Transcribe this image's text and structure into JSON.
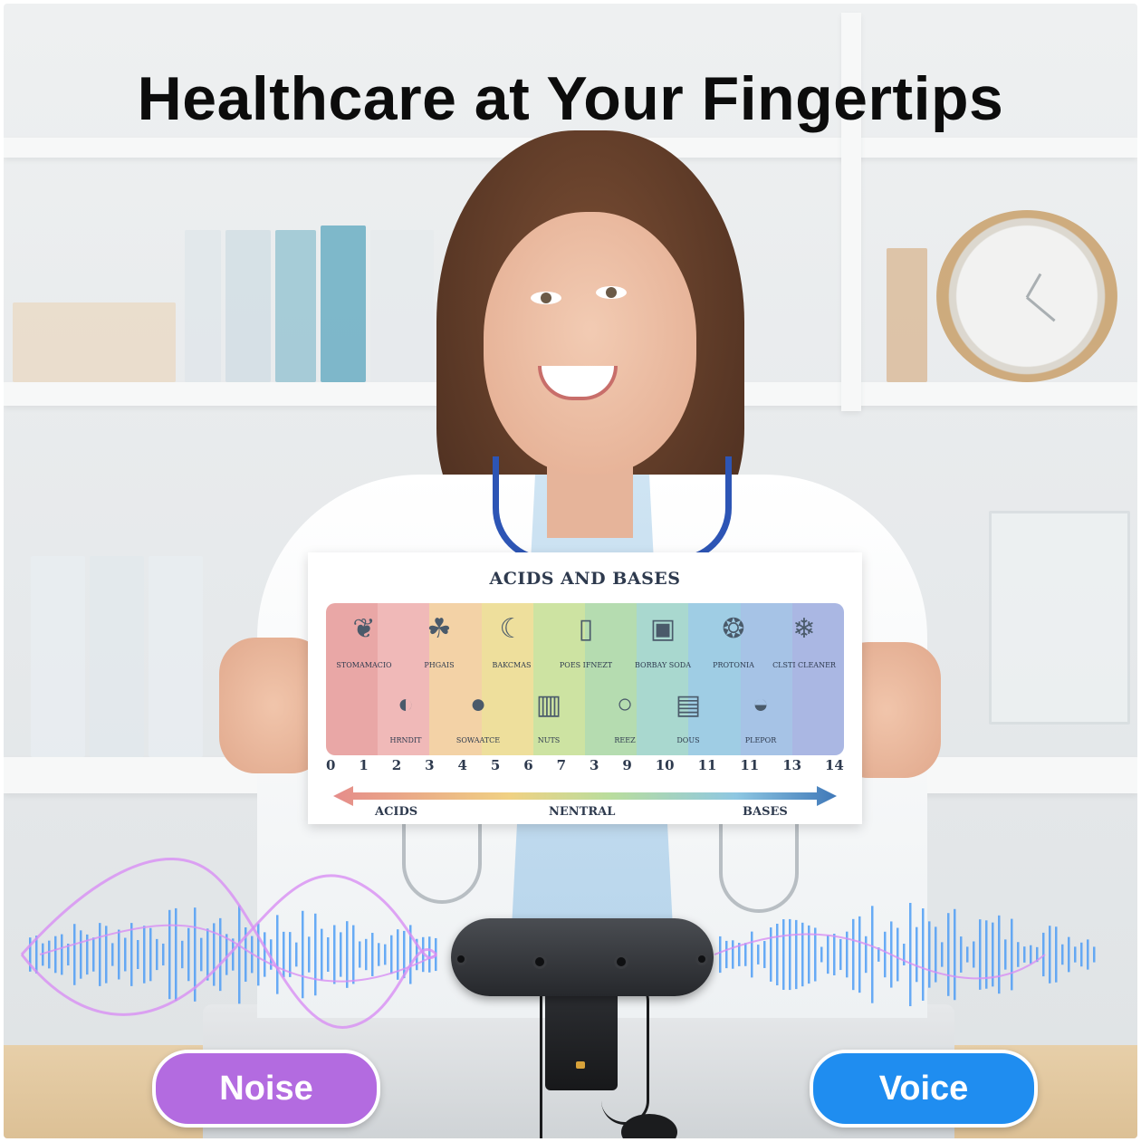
{
  "headline": "Healthcare at Your Fingertips",
  "poster": {
    "title": "ACIDS AND BASES",
    "top_items": [
      {
        "label": "STOMAMACIO",
        "icon": "stomach-icon"
      },
      {
        "label": "PHGAIS",
        "icon": "grapes-icon"
      },
      {
        "label": "BAKCMAS",
        "icon": "banana-icon"
      },
      {
        "label": "POES IFNEZT",
        "icon": "water-glass-icon"
      },
      {
        "label": "BORBAY SODA",
        "icon": "baking-soda-icon"
      },
      {
        "label": "PROTONIA",
        "icon": "bottle-icon"
      },
      {
        "label": "CLSTI CLEANER",
        "icon": "spray-bottle-icon"
      }
    ],
    "bottom_items": [
      {
        "label": "HRNDIT",
        "icon": "lemon-icon"
      },
      {
        "label": "SOWAATCE",
        "icon": "tomato-icon"
      },
      {
        "label": "NUTS",
        "icon": "milk-carton-icon"
      },
      {
        "label": "REEZ",
        "icon": "eggs-icon"
      },
      {
        "label": "DOUS",
        "icon": "soap-dispenser-icon"
      },
      {
        "label": "PLEPOR",
        "icon": "detergent-icon"
      }
    ],
    "scale_numbers": [
      "0",
      "1",
      "2",
      "3",
      "4",
      "5",
      "6",
      "7",
      "3",
      "9",
      "10",
      "11",
      "11",
      "13",
      "14"
    ],
    "acids_label": "ACIDS",
    "neutral_label": "NENTRAL",
    "bases_label": "BASES",
    "band_colors": [
      "#e9a7a6",
      "#f0b9b8",
      "#f3d2a6",
      "#eedf9c",
      "#cde3a2",
      "#b5dcb0",
      "#a9d8cf",
      "#9fcde4",
      "#a6c3e6",
      "#aab7e3"
    ]
  },
  "pills": {
    "noise": "Noise",
    "voice": "Voice"
  },
  "colors": {
    "noise_pill": "#b36be0",
    "voice_pill": "#1f8df0",
    "noise_wave": "#d88ff4",
    "voice_wave": "#4f9df5"
  }
}
